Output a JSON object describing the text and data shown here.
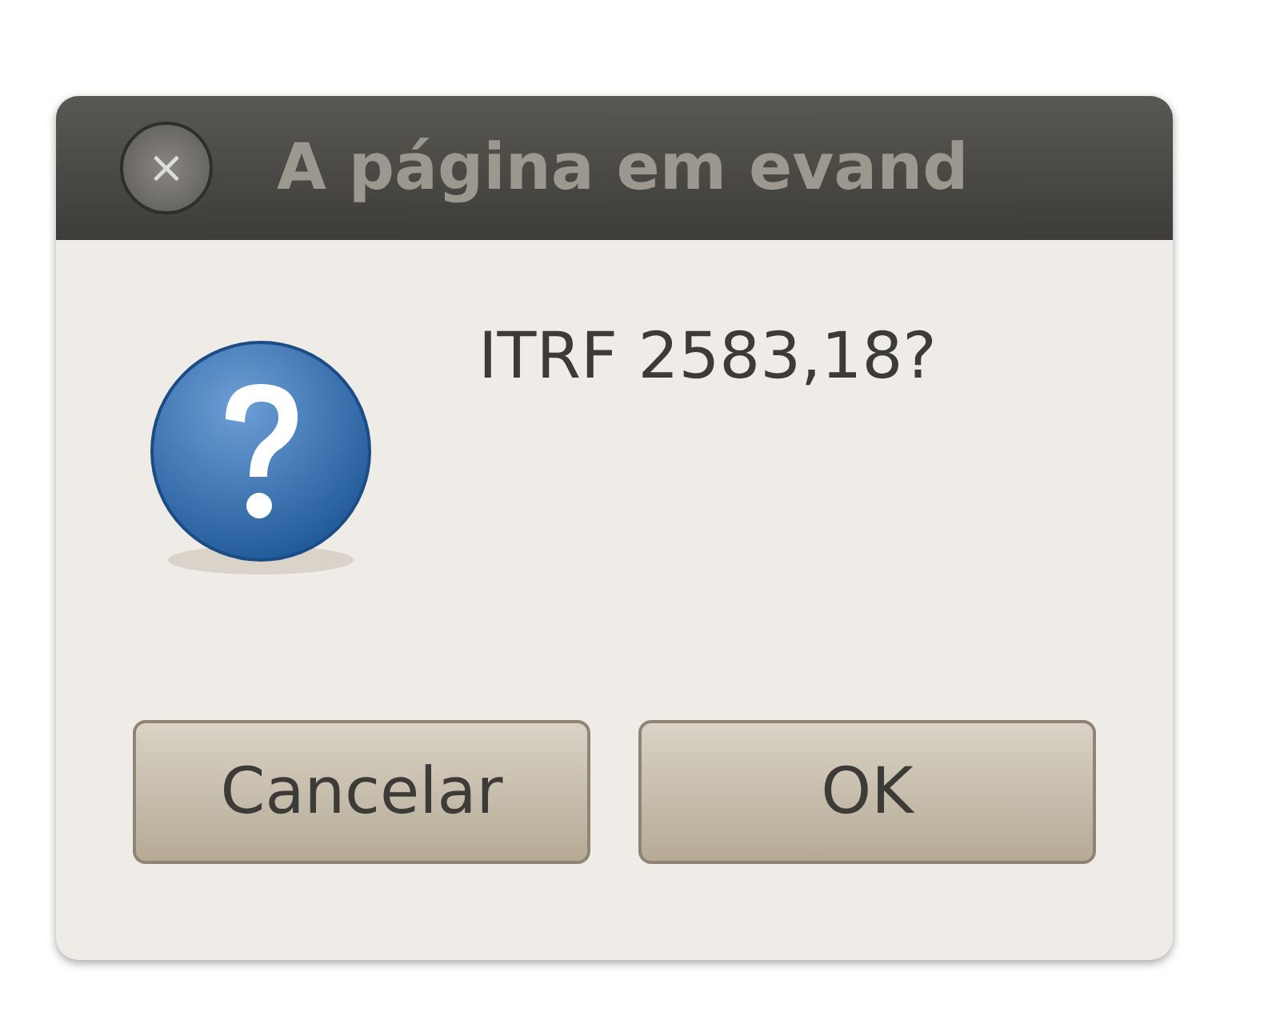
{
  "window": {
    "title": "A página em evand",
    "close_icon": "×"
  },
  "message": "ITRF 2583,18?",
  "buttons": [
    {
      "label": "Cancelar"
    },
    {
      "label": "OK"
    }
  ]
}
